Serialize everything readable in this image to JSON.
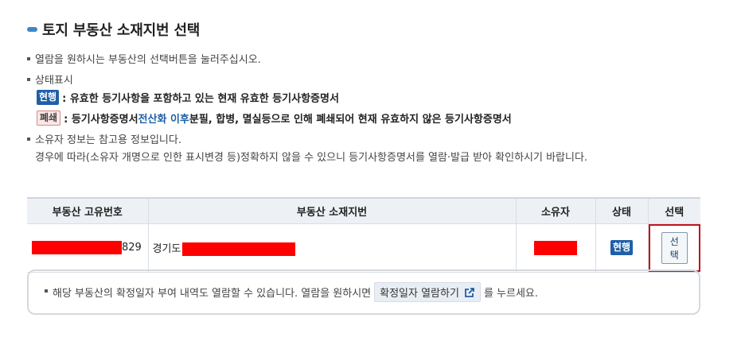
{
  "page_title": "토지 부동산 소재지번 선택",
  "guide_text": "열람을 원하시는 부동산의 선택버튼을 눌러주십시오.",
  "status_heading": "상태표시",
  "status_current": {
    "badge": "현행",
    "desc": ": 유효한 등기사항을 포함하고 있는 현재 유효한 등기사항증명서"
  },
  "status_closed": {
    "badge": "폐쇄",
    "desc_before": ": 등기사항증명서 ",
    "desc_emph": "전산화 이후",
    "desc_after": " 분필, 합병, 멸실등으로 인해 폐쇄되어 현재 유효하지 않은 등기사항증명서"
  },
  "owner_note": {
    "line1": "소유자 정보는 참고용 정보입니다.",
    "line2": "경우에 따라(소유자 개명으로 인한 표시변경 등)정확하지 않을 수 있으니 등기사항증명서를 열람·발급 받아 확인하시기 바랍니다."
  },
  "table": {
    "headers": [
      "부동산 고유번호",
      "부동산 소재지번",
      "소유자",
      "상태",
      "선택"
    ],
    "rows": [
      {
        "id_suffix": "829",
        "address_prefix": "경기도",
        "status": "현행",
        "select_label": "선택"
      }
    ]
  },
  "notice": {
    "text_before": "해당 부동산의 확정일자 부여 내역도 열람할 수 있습니다. 열람을 원하시면",
    "button_label": "확정일자 열람하기",
    "text_after": "를 누르세요."
  },
  "colors": {
    "accent_blue": "#1f5fa8",
    "redaction": "#ff0000",
    "highlight_border": "#c0141c"
  },
  "icons": [
    "title-bullet-icon",
    "external-link-icon"
  ]
}
